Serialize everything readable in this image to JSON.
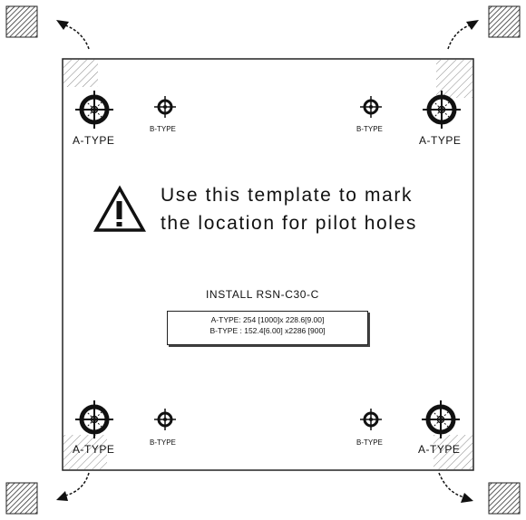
{
  "template": {
    "labels": {
      "a_type": "A-TYPE",
      "b_type": "B-TYPE"
    },
    "instruction": {
      "line1": "Use this template to mark",
      "line2": "the location for pilot holes"
    },
    "install": {
      "title": "INSTALL RSN-C30-C",
      "a_dims": "A-TYPE: 254 [1000]x 228.6[9.00]",
      "b_dims": "B-TYPE : 152.4[6.00] x2286 [900]"
    }
  },
  "colors": {
    "ink": "#111111",
    "hatch": "#555555",
    "paper": "#ffffff"
  }
}
